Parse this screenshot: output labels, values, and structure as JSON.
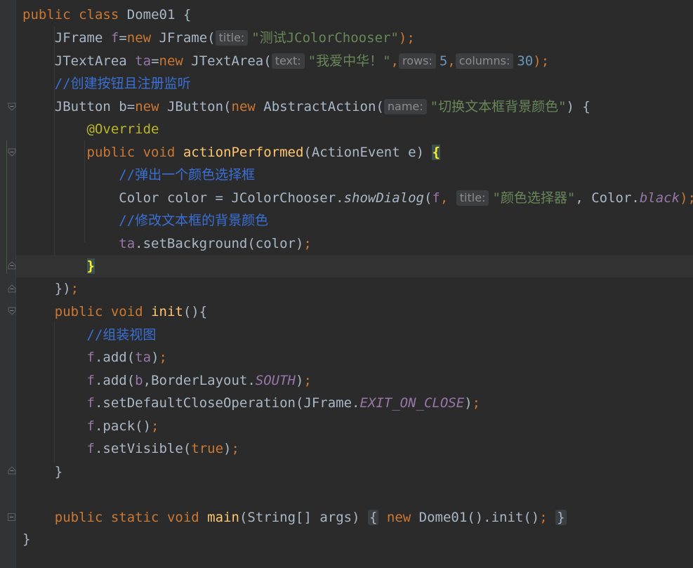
{
  "code": {
    "class_name": "Dome01",
    "line1": {
      "public": "public",
      "class": "class",
      "brace": " {"
    },
    "line2": {
      "type": "JFrame",
      "var": "f",
      "new": "new",
      "ctor": "JFrame(",
      "hint": "title:",
      "arg": "\"测试JColorChooser\"",
      "end": ");"
    },
    "line3": {
      "type": "JTextArea",
      "var": "ta",
      "new": "new",
      "ctor": "JTextArea(",
      "hint_text": "text:",
      "arg_text": "\"我爱中华！\"",
      "hint_rows": "rows:",
      "arg_rows": "5",
      "hint_cols": "columns:",
      "arg_cols": "30",
      "end": ");"
    },
    "line4": {
      "comment_slashes": "//",
      "comment_text": "创建按钮且注册监听"
    },
    "line5": {
      "type": "JButton",
      "var": "b",
      "new": "new",
      "ctor": "JButton(",
      "new2": "new",
      "cls": "AbstractAction(",
      "hint": "name:",
      "arg": "\"切换文本框背景颜色\"",
      "end": ") {"
    },
    "line6": {
      "annotation": "@Override"
    },
    "line7": {
      "public": "public",
      "void": "void",
      "method": "actionPerformed",
      "params": "(ActionEvent e) ",
      "brace": "{"
    },
    "line8": {
      "comment_slashes": "//",
      "comment_text": "弹出一个颜色选择框"
    },
    "line9": {
      "prefix": "Color color = JColorChooser.",
      "method": "showDialog",
      "open": "(",
      "f": "f",
      "comma": ",",
      "hint": "title:",
      "arg": "\"颜色选择器\"",
      "mid": ", Color.",
      "const": "black",
      "end": ");"
    },
    "line10": {
      "comment_slashes": "//",
      "comment_text": "修改文本框的背景颜色"
    },
    "line11": {
      "var": "ta",
      "call": ".setBackground(color)",
      "end": ";"
    },
    "line12": {
      "brace": "}"
    },
    "line13": {
      "text": "})",
      "end": ";"
    },
    "line14": {
      "public": "public",
      "void": "void",
      "method": "init",
      "rest": "(){"
    },
    "line15": {
      "comment_slashes": "//",
      "comment_text": "组装视图"
    },
    "line16": {
      "var": "f",
      "call": ".add(",
      "arg": "ta",
      "close": ")",
      "end": ";"
    },
    "line17": {
      "var": "f",
      "call": ".add(",
      "arg": "b",
      "mid": ",BorderLayout.",
      "const": "SOUTH",
      "close": ")",
      "end": ";"
    },
    "line18": {
      "var": "f",
      "call": ".setDefaultCloseOperation(JFrame.",
      "const": "EXIT_ON_CLOSE",
      "close": ")",
      "end": ";"
    },
    "line19": {
      "var": "f",
      "call": ".pack()",
      "end": ";"
    },
    "line20": {
      "var": "f",
      "call": ".setVisible(",
      "arg": "true",
      "close": ")",
      "end": ";"
    },
    "line21": {
      "brace": "}"
    },
    "line23": {
      "public": "public",
      "static": "static",
      "void": "void",
      "method": "main",
      "params": "(String[] args)",
      "fold_open": "{",
      "new": "new",
      "call": " Dome01().init()",
      "semi": ";",
      "fold_close": "}"
    },
    "line24": {
      "brace": "}"
    }
  },
  "colors": {
    "background": "#2b2b2b",
    "keyword": "#cc7832",
    "string": "#6a8759",
    "number": "#6897bb",
    "field": "#9876aa",
    "method_decl": "#ffc66d",
    "annotation": "#bbb529",
    "comment_cn": "#3a70d6",
    "default_text": "#a9b7c6"
  },
  "icons": [
    "fold-expanded-icon",
    "fold-end-icon",
    "fold-collapsed-icon"
  ]
}
